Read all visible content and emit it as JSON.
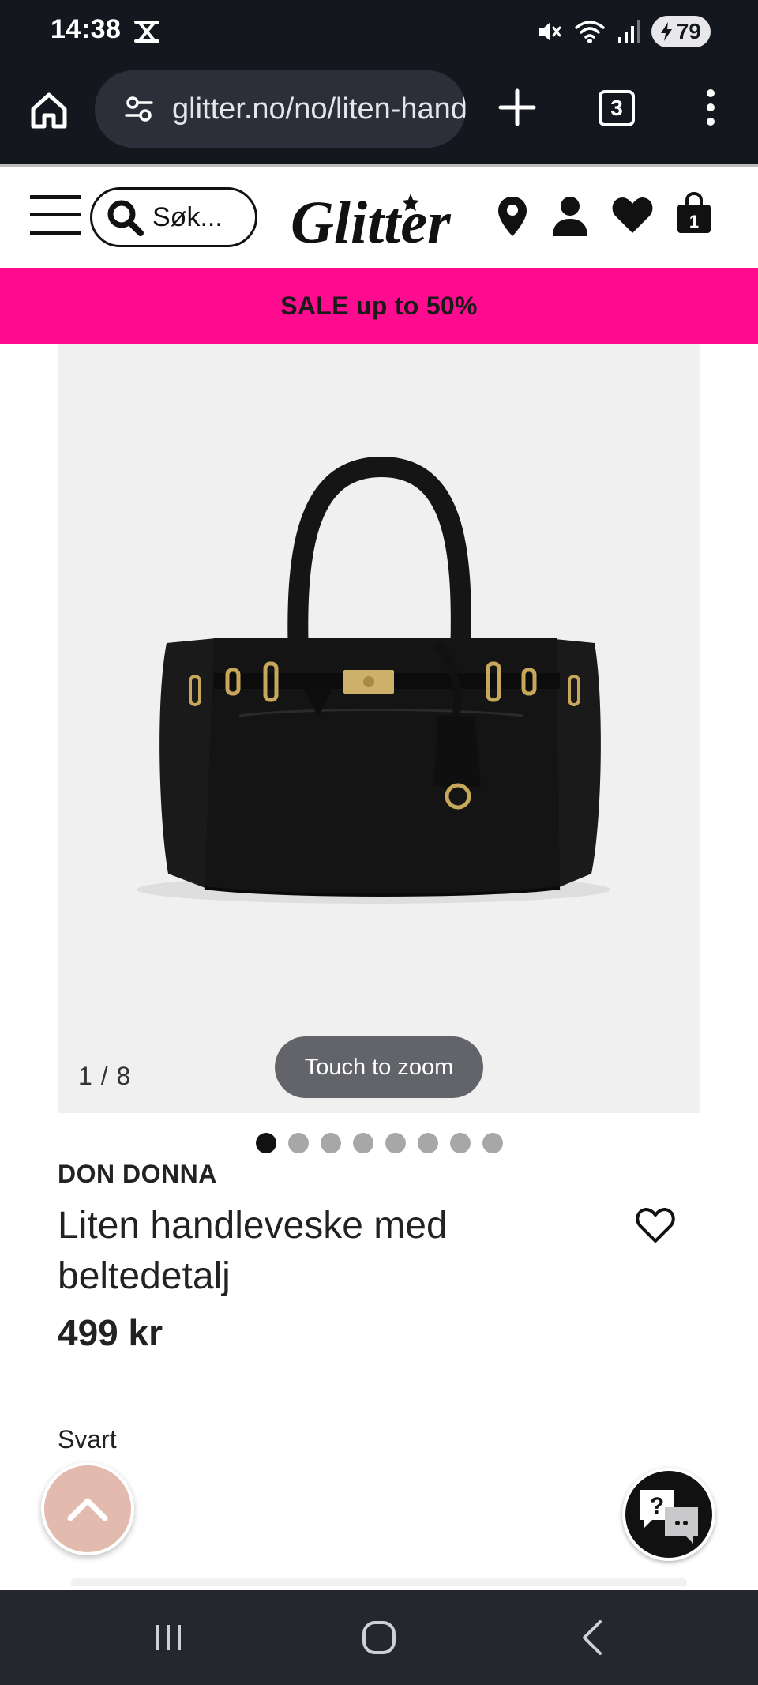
{
  "status_bar": {
    "time": "14:38",
    "battery": "79"
  },
  "browser": {
    "url": "glitter.no/no/liten-handleveske-med-beltedetalj",
    "tab_count": "3"
  },
  "header": {
    "search_placeholder": "Søk...",
    "logo_text": "Glitter"
  },
  "banner": {
    "text": "SALE up to 50%"
  },
  "gallery": {
    "counter": "1 / 8",
    "zoom_hint": "Touch to zoom",
    "total_images": 8,
    "active_index": 0
  },
  "product": {
    "brand": "DON DONNA",
    "title": "Liten handleveske med beltedetalj",
    "price": "499 kr",
    "color": "Svart"
  },
  "colors": {
    "banner_pink": "#ff0b8f",
    "scroll_top_bg": "#e2bbae",
    "browser_bg": "#15171f"
  },
  "icons": {
    "home": "home-icon",
    "tune": "site-settings-icon",
    "plus": "new-tab-icon",
    "menu": "more-vert-icon",
    "search": "search-icon",
    "location": "location-pin-icon",
    "account": "person-icon",
    "wishlist": "heart-icon",
    "cart": "shopping-bag-icon",
    "chat": "chat-help-icon"
  }
}
